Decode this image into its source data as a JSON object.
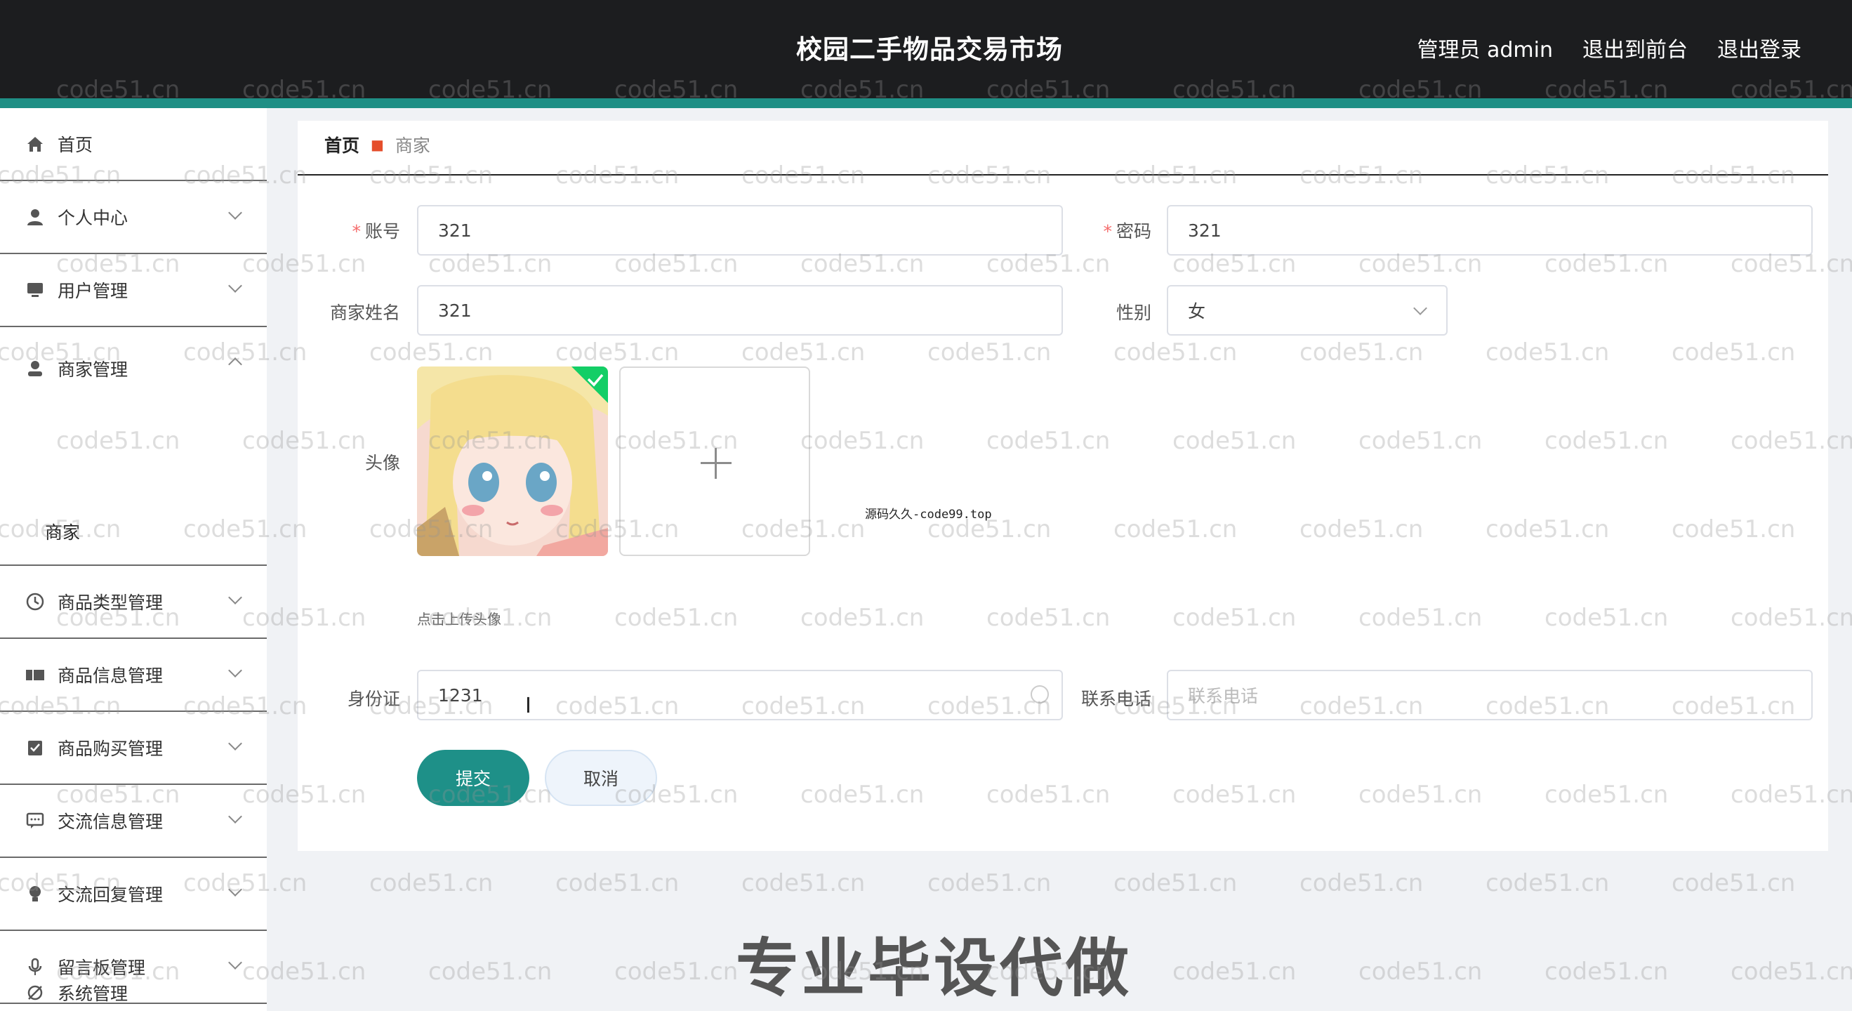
{
  "header": {
    "title": "校园二手物品交易市场",
    "admin_label": "管理员 admin",
    "exit_front": "退出到前台",
    "logout": "退出登录",
    "accent_color": "#1f8f85"
  },
  "sidebar": {
    "items": [
      {
        "label": "首页",
        "icon": "home-icon"
      },
      {
        "label": "个人中心",
        "icon": "user-icon"
      },
      {
        "label": "用户管理",
        "icon": "monitor-icon"
      },
      {
        "label": "商家管理",
        "icon": "person-icon",
        "expanded": true
      },
      {
        "label": "商家",
        "icon": ""
      },
      {
        "label": "商品类型管理",
        "icon": "clock-icon"
      },
      {
        "label": "商品信息管理",
        "icon": "ticket-icon"
      },
      {
        "label": "商品购买管理",
        "icon": "check-box-icon"
      },
      {
        "label": "交流信息管理",
        "icon": "chat-icon"
      },
      {
        "label": "交流回复管理",
        "icon": "bulb-icon"
      },
      {
        "label": "留言板管理",
        "icon": "mic-icon"
      },
      {
        "label": "系统管理",
        "icon": "settings-icon"
      }
    ]
  },
  "breadcrumb": {
    "home": "首页",
    "current": "商家"
  },
  "form": {
    "account": {
      "label": "账号",
      "value": "321"
    },
    "password": {
      "label": "密码",
      "value": "321"
    },
    "merchant_name": {
      "label": "商家姓名",
      "value": "321"
    },
    "gender": {
      "label": "性别",
      "value": "女"
    },
    "avatar": {
      "label": "头像",
      "tip": "点击上传头像"
    },
    "id_card": {
      "label": "身份证",
      "value": "1231"
    },
    "phone": {
      "label": "联系电话",
      "placeholder": "联系电话"
    },
    "submit": "提交",
    "cancel": "取消"
  },
  "overlay": {
    "watermark": "code51.cn",
    "center_tag": "源码久久-code99.top",
    "banner": "专业毕设代做"
  }
}
